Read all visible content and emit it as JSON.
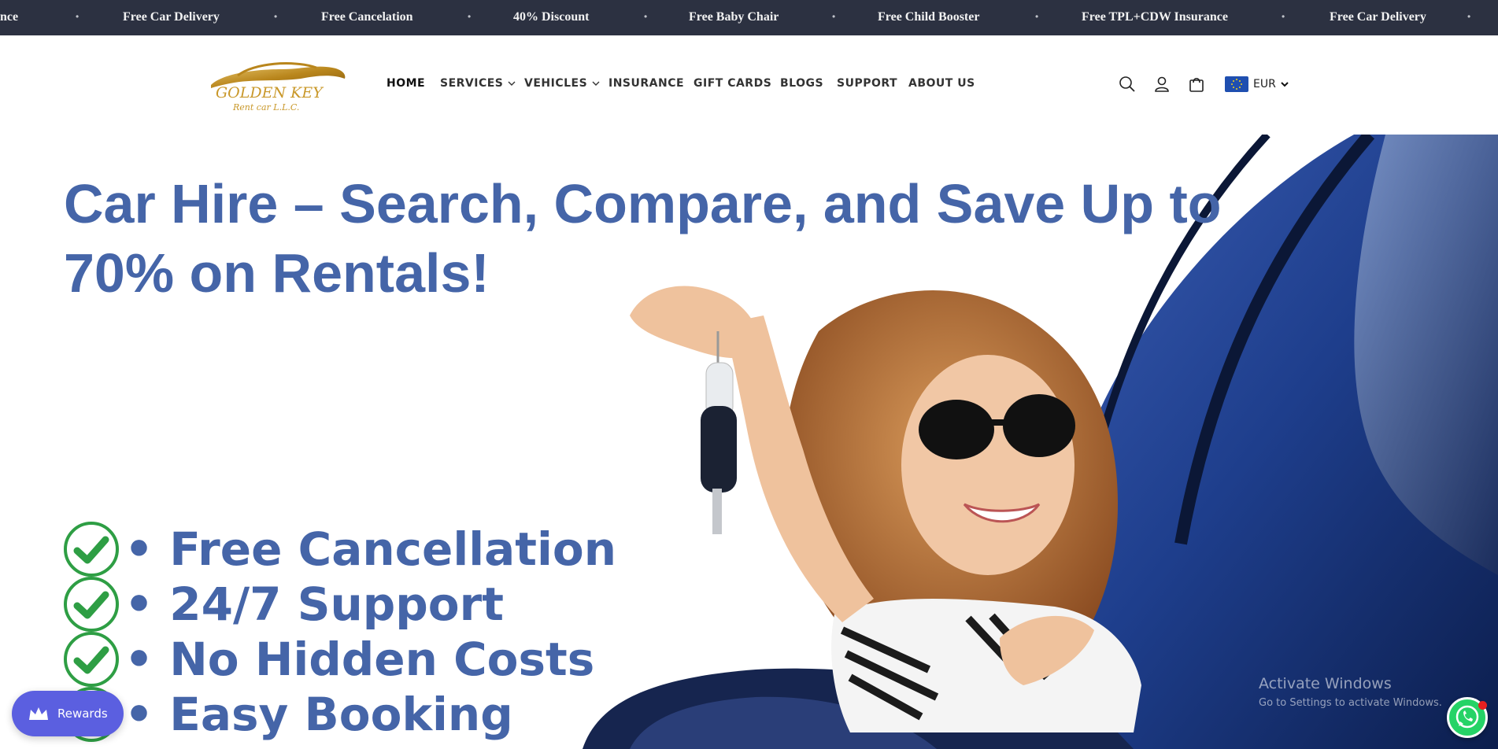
{
  "announcement": {
    "items": [
      "nce",
      "Free Car Delivery",
      "Free Cancelation",
      "40% Discount",
      "Free Baby Chair",
      "Free Child Booster",
      "Free TPL+CDW Insurance",
      "Free Car Delivery"
    ],
    "separator": "•"
  },
  "header": {
    "logo_text_main": "GOLDEN KEY",
    "logo_text_sub": "Rent car L.L.C.",
    "nav": [
      {
        "label": "HOME",
        "dropdown": false,
        "active": true
      },
      {
        "label": "SERVICES",
        "dropdown": true
      },
      {
        "label": "VEHICLES",
        "dropdown": true
      },
      {
        "label": "INSURANCE",
        "dropdown": false
      },
      {
        "label": "GIFT CARDS",
        "dropdown": false
      },
      {
        "label": "BLOGS",
        "dropdown": false
      },
      {
        "label": "SUPPORT",
        "dropdown": false
      },
      {
        "label": "ABOUT US",
        "dropdown": false
      }
    ],
    "icons": [
      "search-icon",
      "account-icon",
      "cart-icon"
    ],
    "currency": "EUR"
  },
  "hero": {
    "title": "Car Hire – Search, Compare, and Save Up to 70% on Rentals!",
    "features": [
      "• Free Cancellation",
      "• 24/7 Support",
      "• No Hidden Costs",
      "• Easy Booking"
    ]
  },
  "widgets": {
    "rewards_label": "Rewards",
    "activate_title": "Activate Windows",
    "activate_sub": "Go to Settings to activate Windows."
  },
  "colors": {
    "announce_bg": "#2c3141",
    "hero_text": "#4565a8",
    "check_green": "#2e9e44",
    "rewards_bg": "#5b5fe0",
    "logo_gold": "#c9982a"
  }
}
